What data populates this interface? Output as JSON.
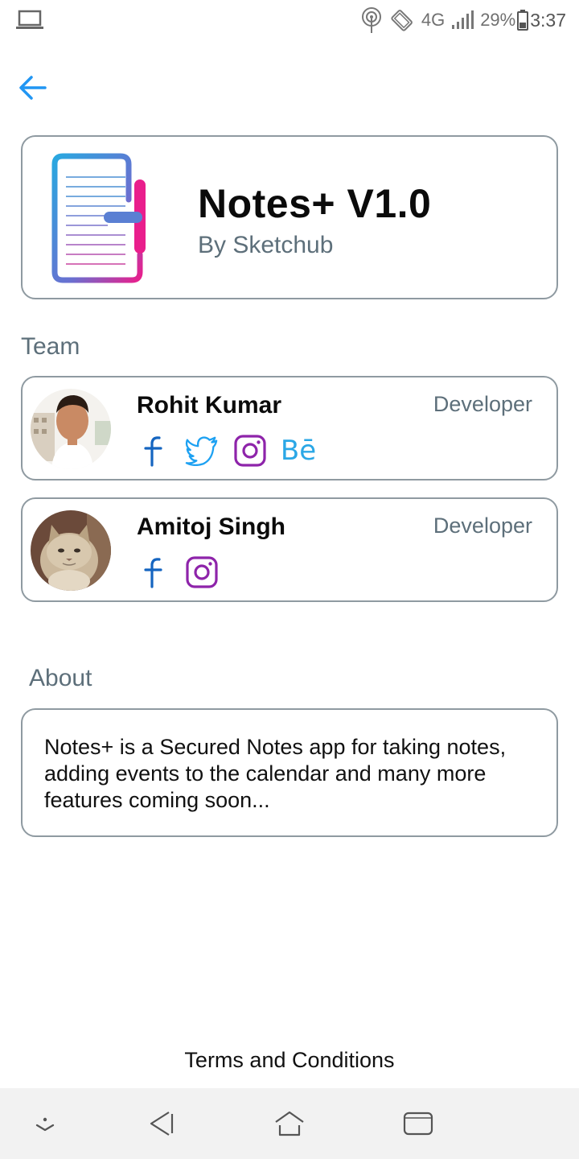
{
  "status_bar": {
    "network": "4G",
    "battery": "29%",
    "time": "3:37",
    "icons": [
      "laptop-icon",
      "hotspot-icon",
      "rotate-icon",
      "signal-icon",
      "battery-icon"
    ]
  },
  "header": {
    "back_icon": "arrow-left-icon"
  },
  "app": {
    "name": "Notes+ V1.0",
    "by": "By Sketchub",
    "logo_icon": "notes-plus-logo"
  },
  "team": {
    "title": "Team",
    "members": [
      {
        "name": "Rohit Kumar",
        "role": "Developer",
        "socials": [
          "facebook",
          "twitter",
          "instagram",
          "behance"
        ]
      },
      {
        "name": "Amitoj Singh",
        "role": "Developer",
        "socials": [
          "facebook",
          "instagram"
        ]
      }
    ]
  },
  "about": {
    "title": "About",
    "text": "Notes+ is a Secured Notes app for taking notes, adding events to the calendar and many more features coming soon..."
  },
  "footer": {
    "terms": "Terms and Conditions"
  },
  "socials": {
    "behance_text": "Bē"
  },
  "colors": {
    "accent_blue": "#2196f3",
    "facebook": "#1565c0",
    "twitter": "#1da1f2",
    "instagram": "#8e24aa",
    "behance": "#2aa7e6",
    "logo_blue": "#29a8e0",
    "logo_pink": "#e91e8c",
    "muted_text": "#5d6f7a",
    "card_border": "#8f9aa1"
  }
}
